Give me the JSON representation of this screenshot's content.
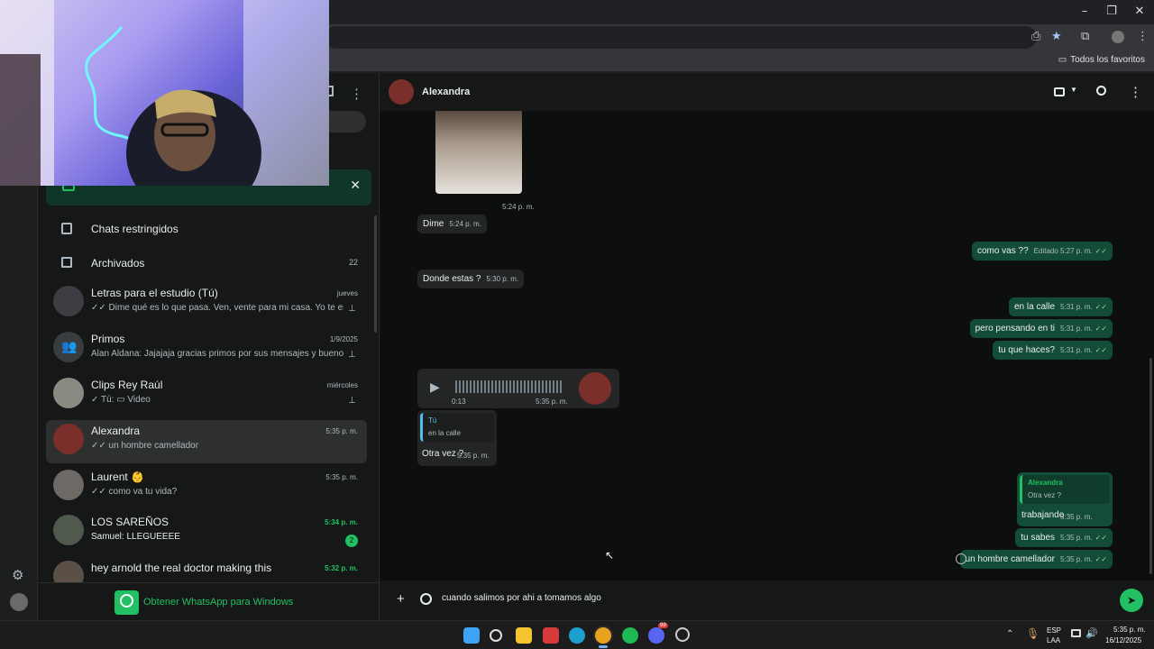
{
  "browser": {
    "controls": {
      "minimize": "–",
      "restore": "❐",
      "close": "✕"
    },
    "bookmarks_label": "Todos los favoritos"
  },
  "sidebar": {
    "restricted_label": "Chats restringidos",
    "archived_label": "Archivados",
    "archived_count": "22",
    "get_app_label": "Obtener WhatsApp para Windows",
    "chats": [
      {
        "name": "Letras para el estudio (Tú)",
        "time": "jueves",
        "preview": "✓✓ Dime qué es lo que pasa. Ven, vente para mi casa. Yo te esper...",
        "pinned": "true"
      },
      {
        "name": "Primos",
        "time": "1/9/2025",
        "preview": "Alan Aldana: Jajajaja gracias primos por sus mensajes y buenos ...",
        "pinned": "true"
      },
      {
        "name": "Clips Rey Raúl",
        "time": "miércoles",
        "preview": "✓ Tú: ▭ Video",
        "pinned": "true"
      },
      {
        "name": "Alexandra",
        "time": "5:35 p. m.",
        "preview": "✓✓ un hombre camellador"
      },
      {
        "name": "Laurent 👶",
        "time": "5:35 p. m.",
        "preview": "✓✓ como va tu vida?"
      },
      {
        "name": "LOS SAREÑOS",
        "time": "5:34 p. m.",
        "preview": "Samuel: LLEGUEEEE",
        "unread": "2"
      },
      {
        "name": "hey arnold the real doctor making this",
        "time": "5:32 p. m."
      }
    ]
  },
  "chat": {
    "contact_name": "Alexandra",
    "image_time": "5:24 p. m.",
    "messages_in": [
      {
        "text": "Dime",
        "time": "5:24 p. m."
      },
      {
        "text": "Donde estas ?",
        "time": "5:30 p. m."
      }
    ],
    "voice": {
      "duration": "0:13",
      "time": "5:35 p. m."
    },
    "reply_in": {
      "quoted_author": "Tú",
      "quoted_text": "en la calle",
      "text": "Otra vez ?",
      "time": "5:35 p. m."
    },
    "messages_out": [
      {
        "text": "como vas ??",
        "time": "Editado 5:27 p. m."
      },
      {
        "text": "en la calle",
        "time": "5:31 p. m."
      },
      {
        "text": "pero pensando en ti",
        "time": "5:31 p. m."
      },
      {
        "text": "tu que haces?",
        "time": "5:31 p. m."
      }
    ],
    "reply_out": {
      "quoted_author": "Alexandra",
      "quoted_text": "Otra vez ?",
      "text": "trabajando",
      "time": "5:35 p. m."
    },
    "messages_out2": [
      {
        "text": "tu sabes",
        "time": "5:35 p. m."
      },
      {
        "text": "un hombre camellador",
        "time": "5:35 p. m."
      }
    ],
    "composer_value": "cuando salimos por ahi a tomamos algo"
  },
  "taskbar": {
    "lang_top": "ESP",
    "lang_bottom": "LAA",
    "clock_time": "5:35 p. m.",
    "clock_date": "16/12/2025",
    "discord_badge": "99"
  }
}
